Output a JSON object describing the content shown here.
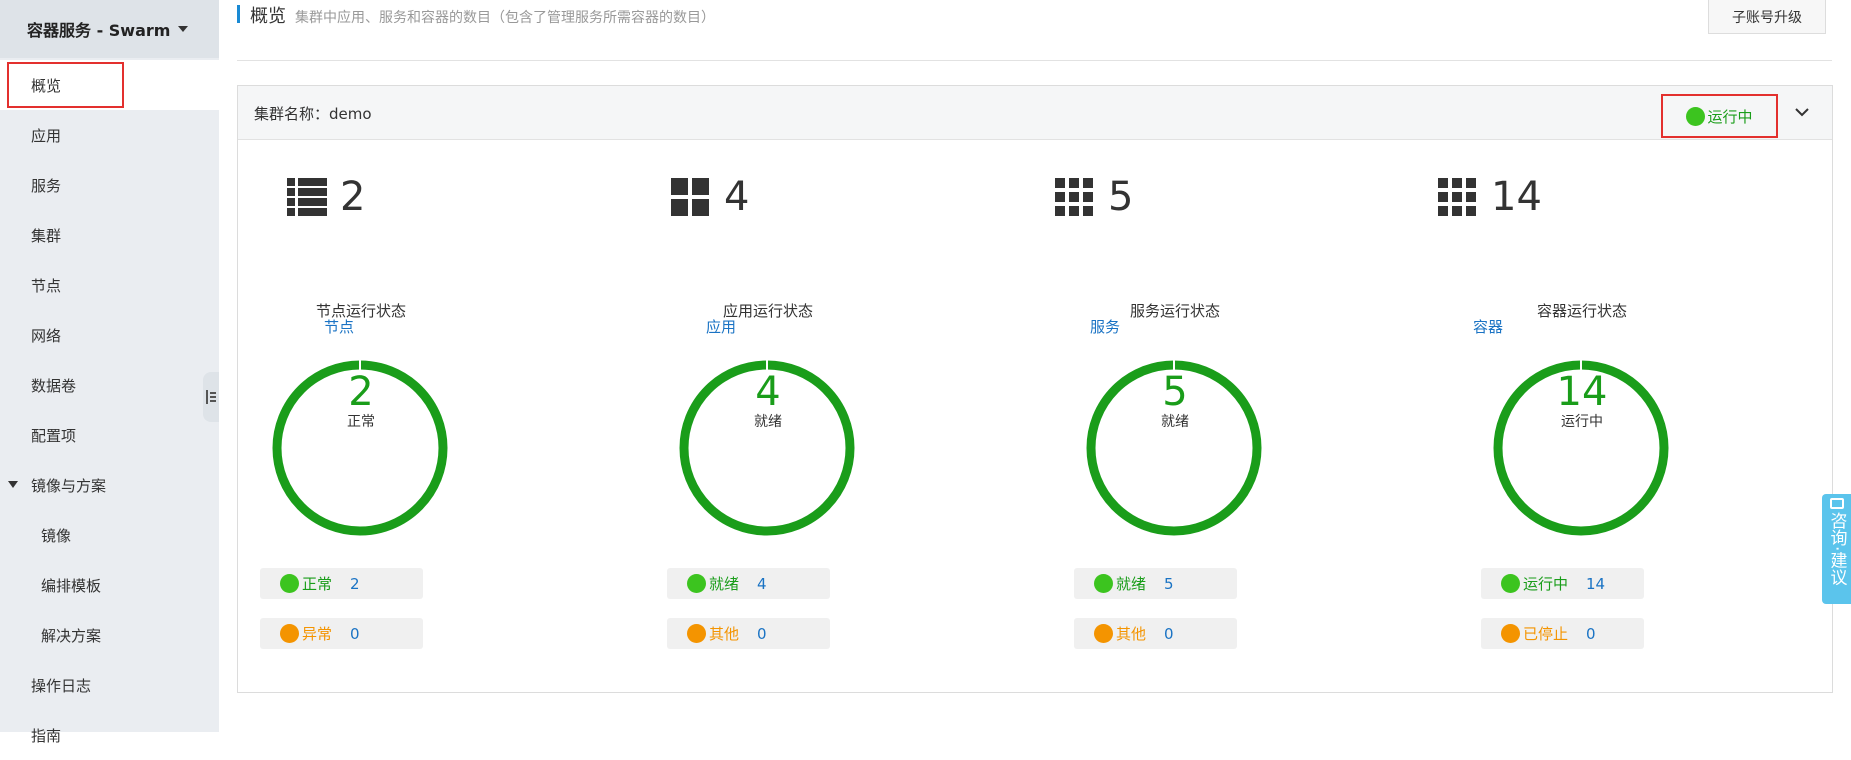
{
  "sidebar": {
    "title": "容器服务 - Swarm",
    "items": [
      {
        "label": "概览"
      },
      {
        "label": "应用"
      },
      {
        "label": "服务"
      },
      {
        "label": "集群"
      },
      {
        "label": "节点"
      },
      {
        "label": "网络"
      },
      {
        "label": "数据卷"
      },
      {
        "label": "配置项"
      },
      {
        "label": "镜像与方案"
      },
      {
        "label": "镜像"
      },
      {
        "label": "编排模板"
      },
      {
        "label": "解决方案"
      },
      {
        "label": "操作日志"
      },
      {
        "label": "指南"
      }
    ]
  },
  "header": {
    "title": "概览",
    "description": "集群中应用、服务和容器的数目（包含了管理服务所需容器的数目）",
    "upgrade_button": "子账号升级"
  },
  "cluster": {
    "name_label": "集群名称：demo",
    "status": "运行中"
  },
  "stats": [
    {
      "value": "2",
      "label": "节点",
      "icon": "list-icon"
    },
    {
      "value": "4",
      "label": "应用",
      "icon": "grid-4-icon"
    },
    {
      "value": "5",
      "label": "服务",
      "icon": "grid-9-icon"
    },
    {
      "value": "14",
      "label": "容器",
      "icon": "grid-9-icon"
    }
  ],
  "charts": [
    {
      "title": "节点运行状态",
      "total": "2",
      "center_label": "正常",
      "ok_label": "正常",
      "ok_value": "2",
      "bad_label": "异常",
      "bad_value": "0"
    },
    {
      "title": "应用运行状态",
      "total": "4",
      "center_label": "就绪",
      "ok_label": "就绪",
      "ok_value": "4",
      "bad_label": "其他",
      "bad_value": "0"
    },
    {
      "title": "服务运行状态",
      "total": "5",
      "center_label": "就绪",
      "ok_label": "就绪",
      "ok_value": "5",
      "bad_label": "其他",
      "bad_value": "0"
    },
    {
      "title": "容器运行状态",
      "total": "14",
      "center_label": "运行中",
      "ok_label": "运行中",
      "ok_value": "14",
      "bad_label": "已停止",
      "bad_value": "0"
    }
  ],
  "feedback": {
    "label": "咨询·建议"
  },
  "colors": {
    "ok": "#3cc41f",
    "ring": "#1a9d1a",
    "warn": "#f49400",
    "link": "#1a73c4"
  }
}
